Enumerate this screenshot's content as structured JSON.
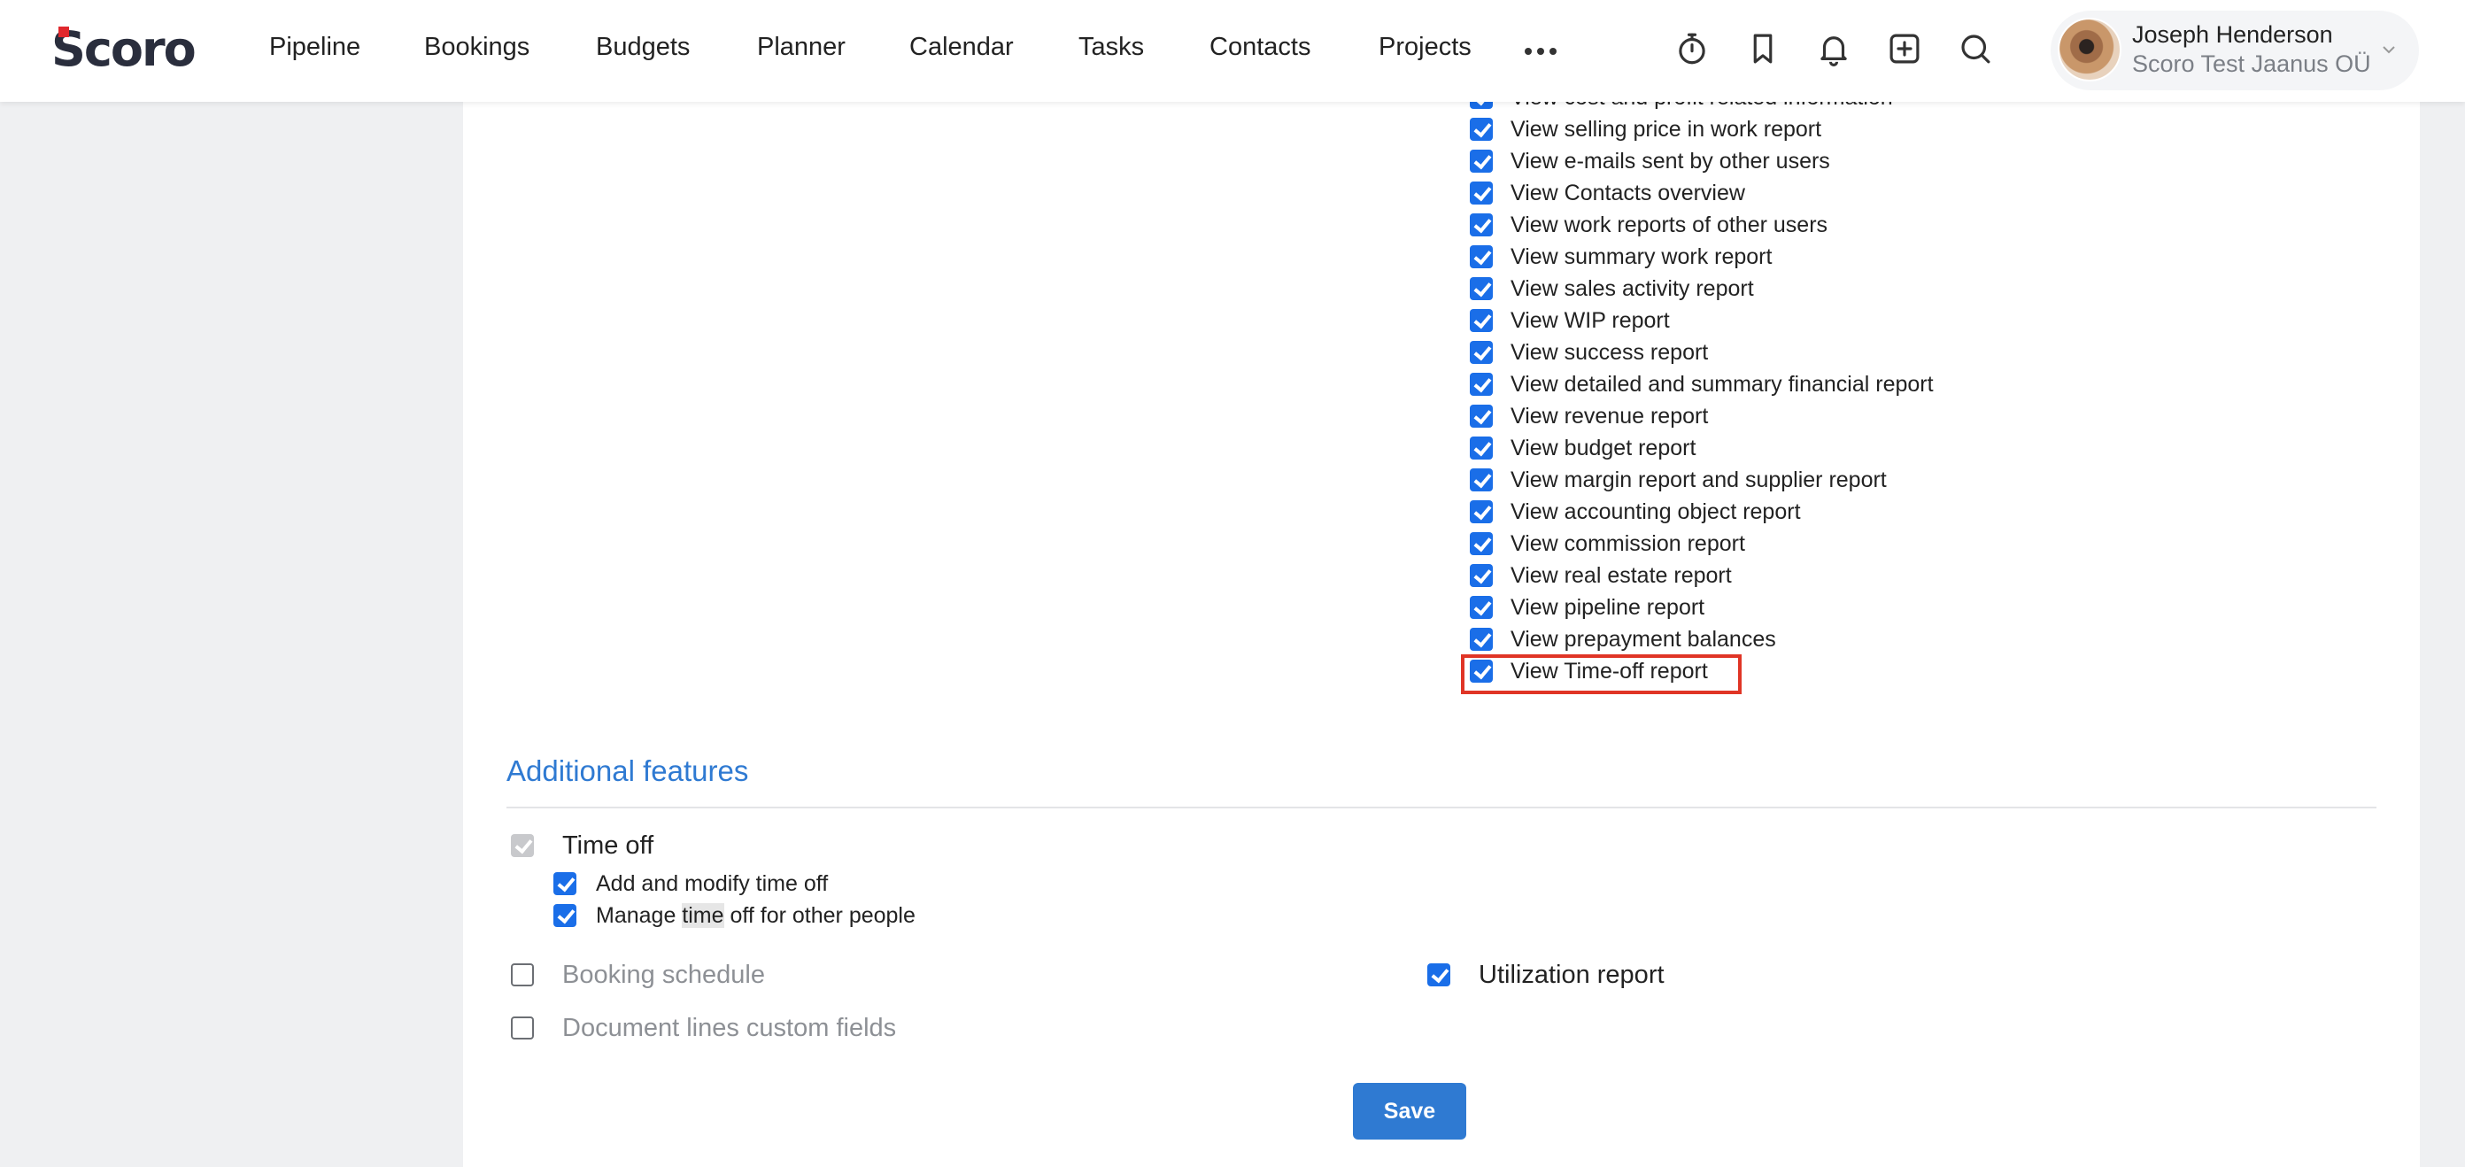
{
  "app": {
    "logo_text": "Scoro"
  },
  "nav": {
    "items": [
      "Pipeline",
      "Bookings",
      "Budgets",
      "Planner",
      "Calendar",
      "Tasks",
      "Contacts",
      "Projects"
    ]
  },
  "header_icons": [
    "more-icon",
    "timer-icon",
    "bookmark-icon",
    "bell-icon",
    "add-icon",
    "search-icon"
  ],
  "user": {
    "name": "Joseph Henderson",
    "company": "Scoro Test Jaanus OÜ"
  },
  "permissions": [
    {
      "label": "View cost and profit related information",
      "checked": true
    },
    {
      "label": "View selling price in work report",
      "checked": true
    },
    {
      "label": "View e-mails sent by other users",
      "checked": true
    },
    {
      "label": "View Contacts overview",
      "checked": true
    },
    {
      "label": "View work reports of other users",
      "checked": true
    },
    {
      "label": "View summary work report",
      "checked": true
    },
    {
      "label": "View sales activity report",
      "checked": true
    },
    {
      "label": "View WIP report",
      "checked": true
    },
    {
      "label": "View success report",
      "checked": true
    },
    {
      "label": "View detailed and summary financial report",
      "checked": true
    },
    {
      "label": "View revenue report",
      "checked": true
    },
    {
      "label": "View budget report",
      "checked": true
    },
    {
      "label": "View margin report and supplier report",
      "checked": true
    },
    {
      "label": "View accounting object report",
      "checked": true
    },
    {
      "label": "View commission report",
      "checked": true
    },
    {
      "label": "View real estate report",
      "checked": true
    },
    {
      "label": "View pipeline report",
      "checked": true
    },
    {
      "label": "View prepayment balances",
      "checked": true
    },
    {
      "label": "View Time-off report",
      "checked": true
    }
  ],
  "additional_features": {
    "title": "Additional features",
    "time_off": {
      "label": "Time off",
      "checked": true,
      "disabled": true,
      "sub": [
        {
          "label": "Add and modify time off",
          "checked": true
        },
        {
          "label_before": "Manage ",
          "label_highlight": "time",
          "label_after": " off for other people",
          "checked": true
        }
      ]
    },
    "booking_schedule": {
      "label": "Booking schedule",
      "checked": false
    },
    "document_lines": {
      "label": "Document lines custom fields",
      "checked": false
    },
    "utilization_report": {
      "label": "Utilization report",
      "checked": true
    }
  },
  "actions": {
    "save_label": "Save"
  },
  "colors": {
    "accent": "#2f7ad2",
    "checkbox": "#1a6ee8",
    "highlight_box": "#e03526"
  }
}
